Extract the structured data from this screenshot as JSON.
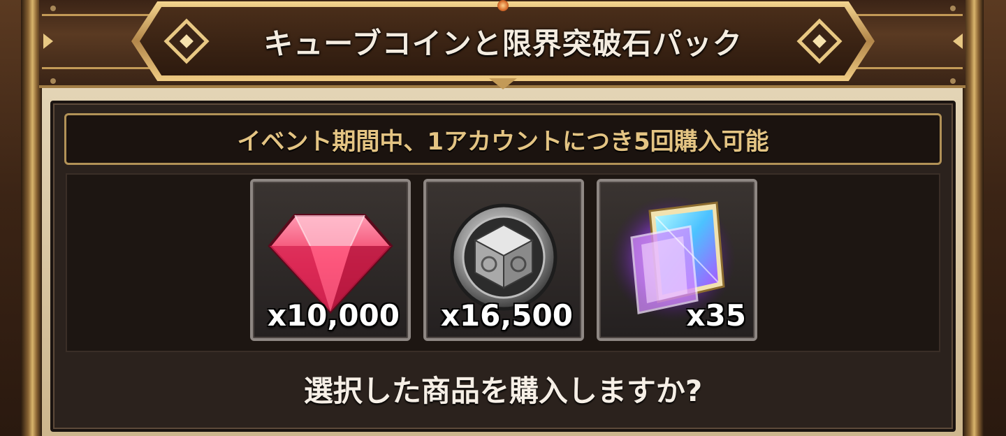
{
  "dialog": {
    "title": "キューブコインと限界突破石パック",
    "notice": "イベント期間中、1アカウントにつき5回購入可能",
    "question": "選択した商品を購入しますか?"
  },
  "items": [
    {
      "icon": "ruby-gem-icon",
      "quantity": "x10,000"
    },
    {
      "icon": "cube-coin-icon",
      "quantity": "x16,500"
    },
    {
      "icon": "limit-break-stone-icon",
      "quantity": "x35"
    }
  ],
  "colors": {
    "accent_gold": "#e4c483",
    "panel_dark": "#2b221d",
    "frame_brown": "#3b2415"
  }
}
